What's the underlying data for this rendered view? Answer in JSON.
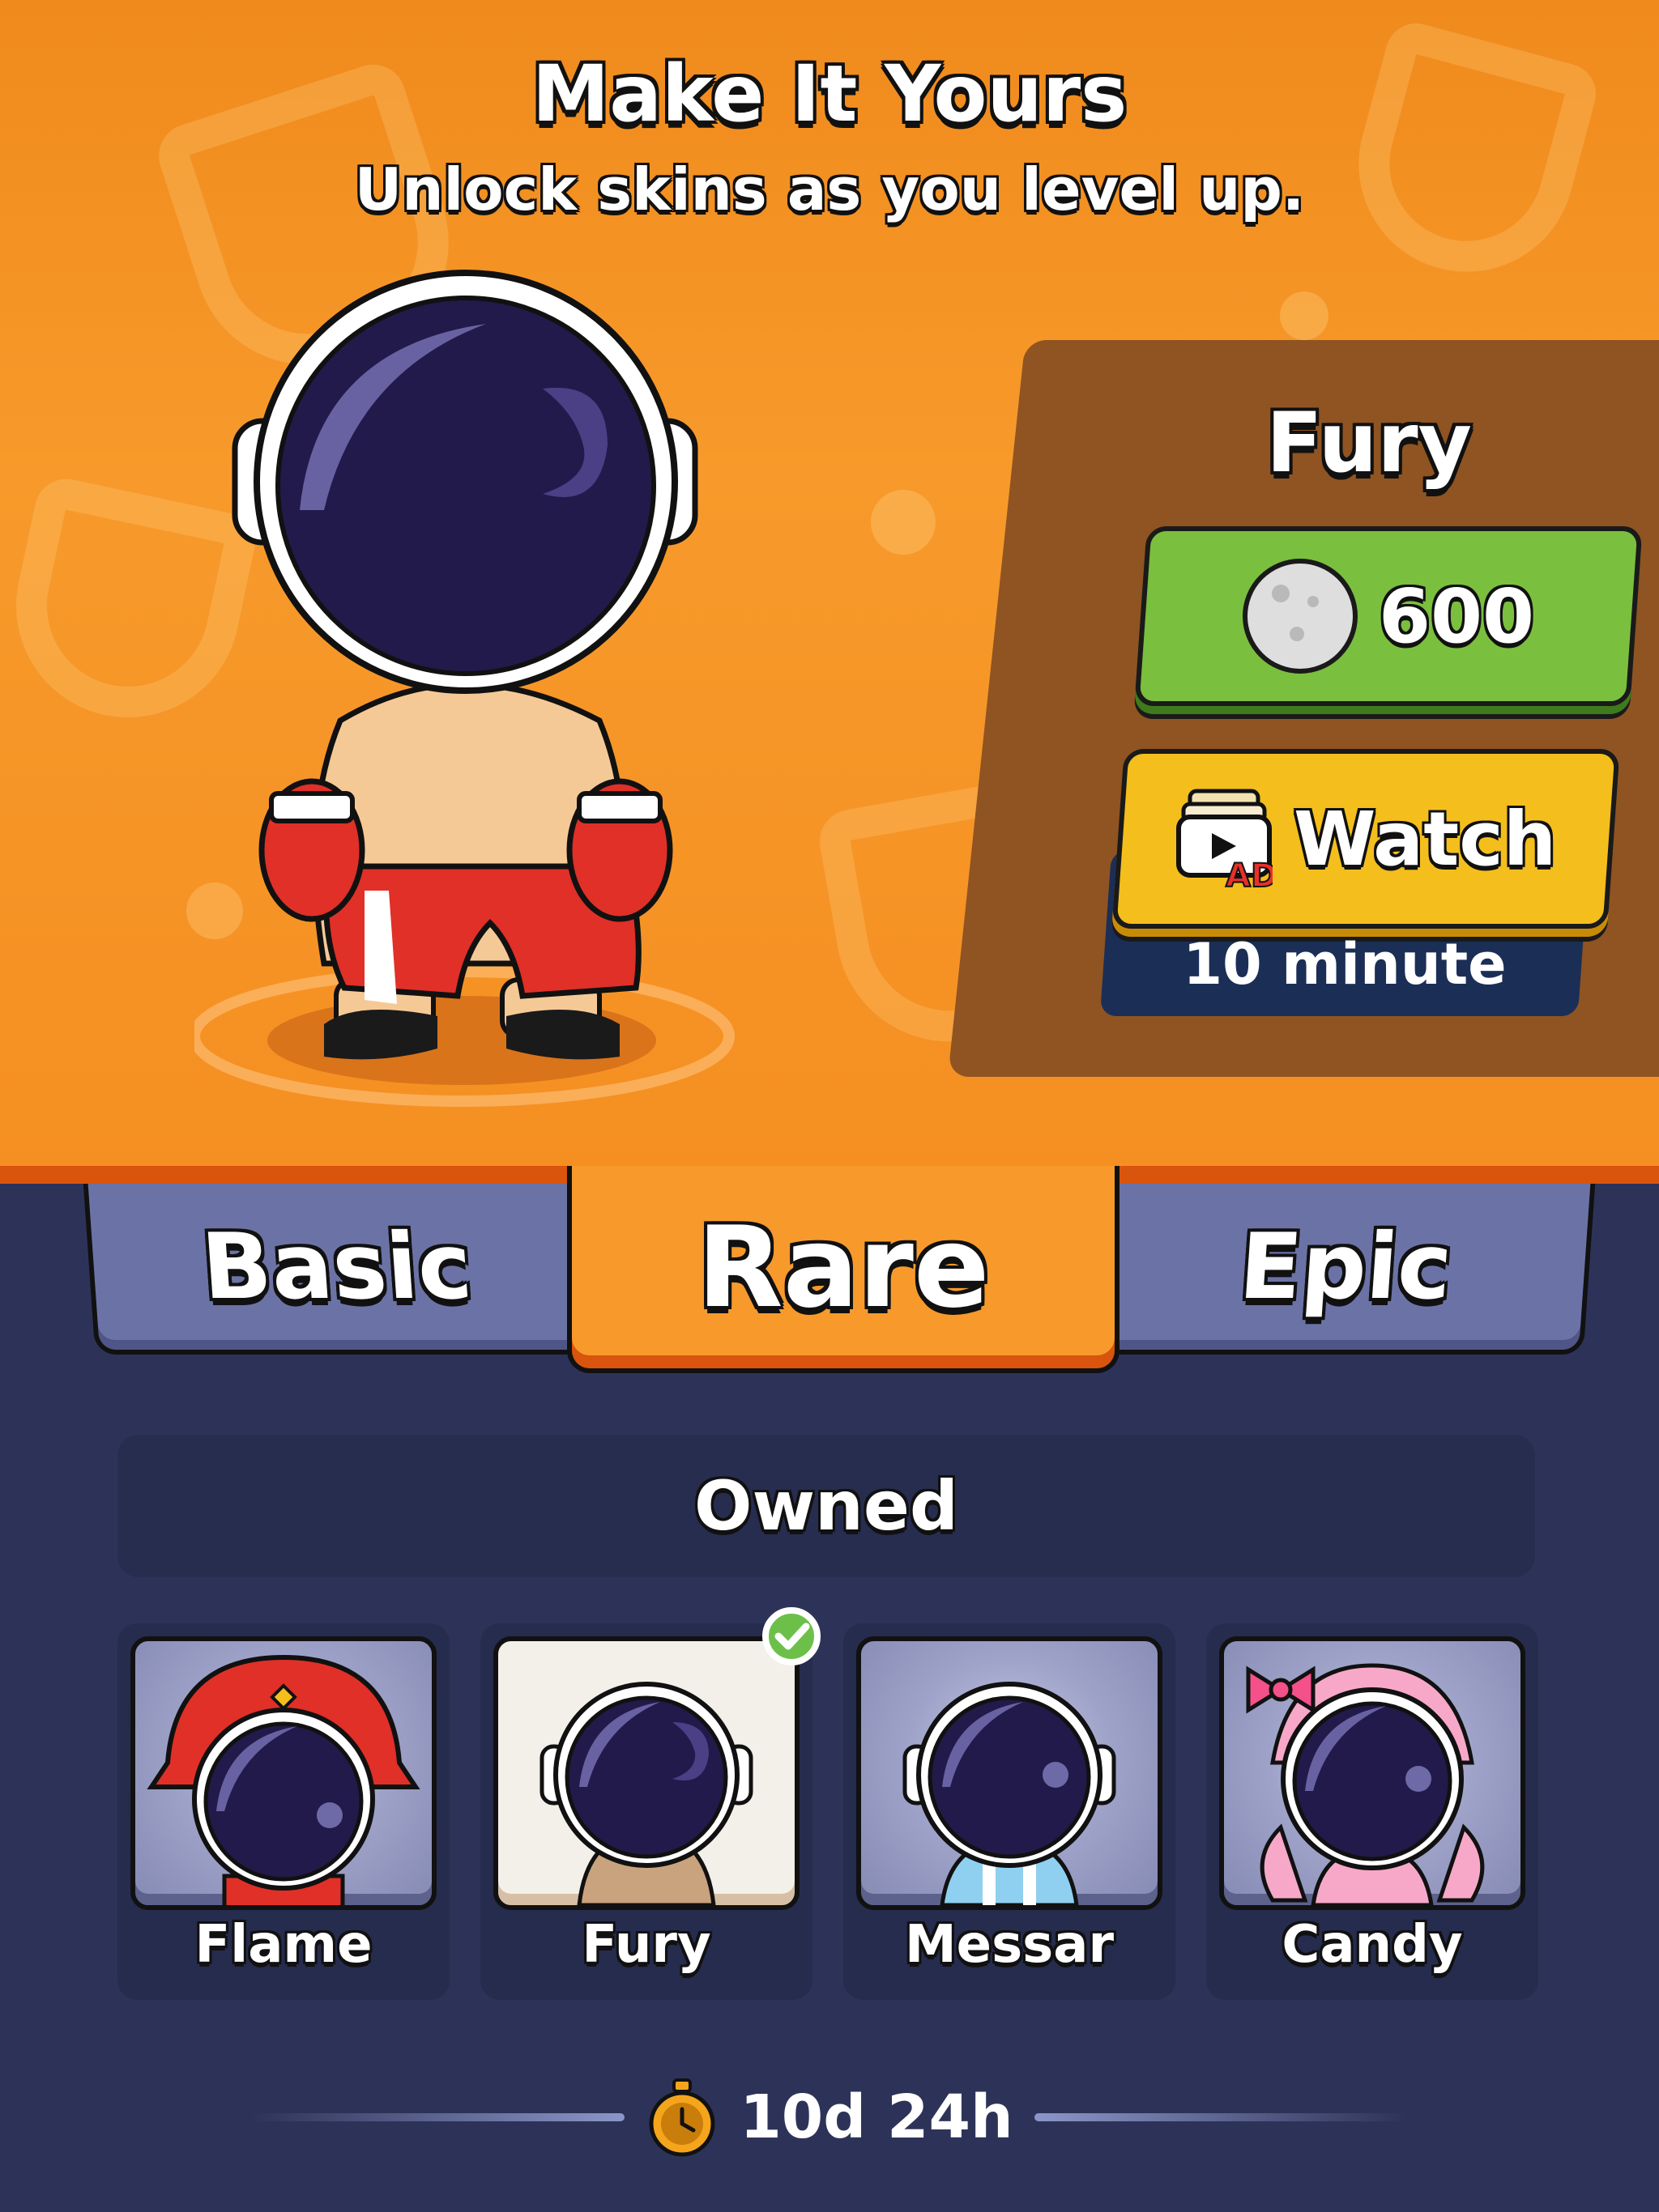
{
  "header": {
    "title": "Make It Yours",
    "subtitle": "Unlock skins as you level up."
  },
  "offer": {
    "skin_name": "Fury",
    "price": "600",
    "price_icon": "moon-coin-icon",
    "watch_label": "Watch",
    "watch_icon": "ad-video-icon",
    "watch_timer": "10 minute"
  },
  "tabs": [
    {
      "label": "Basic",
      "selected": false
    },
    {
      "label": "Rare",
      "selected": true
    },
    {
      "label": "Epic",
      "selected": false
    }
  ],
  "section": {
    "label": "Owned"
  },
  "skins": [
    {
      "name": "Flame",
      "selected": false
    },
    {
      "name": "Fury",
      "selected": true
    },
    {
      "name": "Messar",
      "selected": false
    },
    {
      "name": "Candy",
      "selected": false
    }
  ],
  "footer": {
    "timer": "10d 24h",
    "timer_icon": "stopwatch-icon"
  },
  "colors": {
    "hero_orange": "#f79a2b",
    "buy_green": "#7bbf3e",
    "watch_yellow": "#f4be1c",
    "tab_inactive": "#6b73a6",
    "background": "#2d3358"
  }
}
